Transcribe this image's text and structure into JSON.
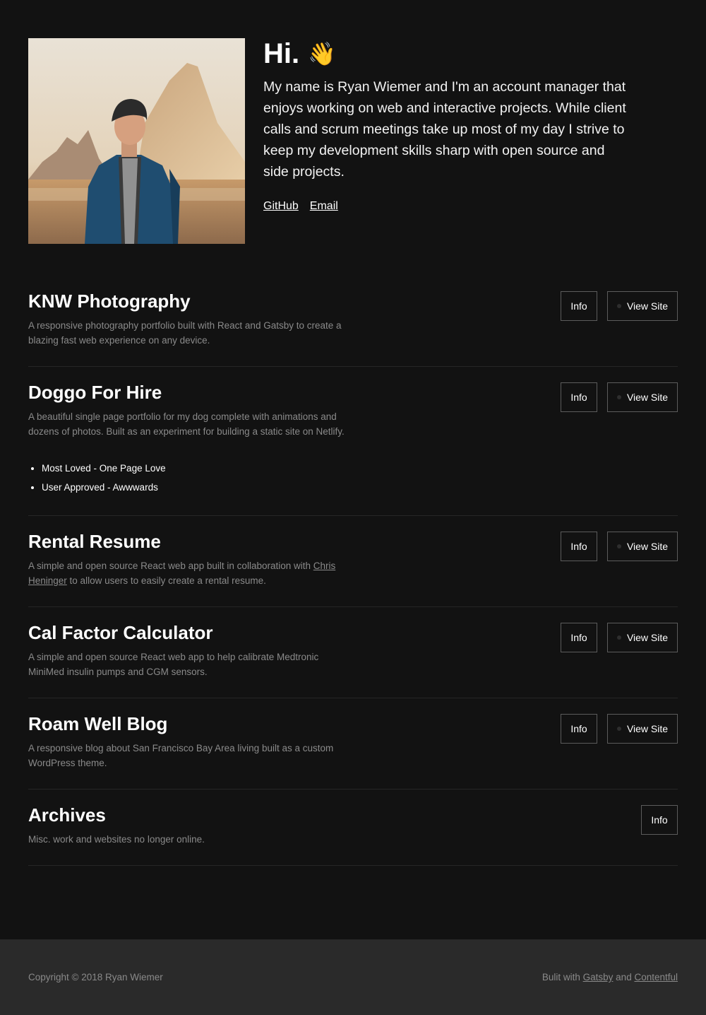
{
  "intro": {
    "greeting": "Hi.",
    "wave_emoji": "👋",
    "bio": "My name is Ryan Wiemer and I'm an account manager that enjoys working on web and interactive projects. While client calls and scrum meetings take up most of my day I strive to keep my development skills sharp with open source and side projects.",
    "links": {
      "github": "GitHub",
      "email": "Email"
    }
  },
  "projects": [
    {
      "title": "KNW Photography",
      "description": "A responsive photography portfolio built with React and Gatsby to create a blazing fast web experience on any device.",
      "info_label": "Info",
      "view_label": "View Site"
    },
    {
      "title": "Doggo For Hire",
      "description": "A beautiful single page portfolio for my dog complete with animations and dozens of photos. Built as an experiment for building a static site on Netlify.",
      "awards": [
        "Most Loved - One Page Love",
        "User Approved - Awwwards"
      ],
      "info_label": "Info",
      "view_label": "View Site"
    },
    {
      "title": "Rental Resume",
      "description_before": "A simple and open source React web app built in collaboration with ",
      "description_link": "Chris Heninger",
      "description_after": " to allow users to easily create a rental resume.",
      "info_label": "Info",
      "view_label": "View Site"
    },
    {
      "title": "Cal Factor Calculator",
      "description": "A simple and open source React web app to help calibrate Medtronic MiniMed insulin pumps and CGM sensors.",
      "info_label": "Info",
      "view_label": "View Site"
    },
    {
      "title": "Roam Well Blog",
      "description": "A responsive blog about San Francisco Bay Area living built as a custom WordPress theme.",
      "info_label": "Info",
      "view_label": "View Site"
    },
    {
      "title": "Archives",
      "description": "Misc. work and websites no longer online.",
      "info_label": "Info"
    }
  ],
  "footer": {
    "copyright": "Copyright © 2018 Ryan Wiemer",
    "built_prefix": "Bulit with ",
    "gatsby": "Gatsby",
    "and": " and ",
    "contentful": "Contentful"
  }
}
